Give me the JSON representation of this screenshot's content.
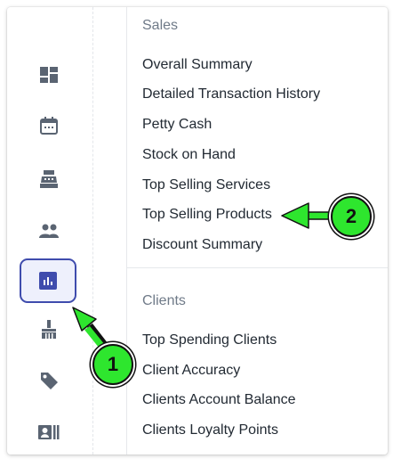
{
  "sidebar": {
    "icons": [
      {
        "name": "dashboard-icon",
        "active": false
      },
      {
        "name": "calendar-icon",
        "active": false
      },
      {
        "name": "cash-register-icon",
        "active": false
      },
      {
        "name": "clients-icon",
        "active": false
      },
      {
        "name": "reports-icon",
        "active": true
      },
      {
        "name": "services-icon",
        "active": false
      },
      {
        "name": "tag-icon",
        "active": false
      },
      {
        "name": "id-card-icon",
        "active": false
      }
    ]
  },
  "menu": {
    "sales": {
      "heading": "Sales",
      "items": [
        "Overall Summary",
        "Detailed Transaction History",
        "Petty Cash",
        "Stock on Hand",
        "Top Selling Services",
        "Top Selling Products",
        "Discount Summary"
      ]
    },
    "clients": {
      "heading": "Clients",
      "items": [
        "Top Spending Clients",
        "Client Accuracy",
        "Clients Account Balance",
        "Clients Loyalty Points"
      ]
    }
  },
  "callouts": [
    {
      "number": "1",
      "target": "reports-icon"
    },
    {
      "number": "2",
      "target": "Top Selling Products"
    }
  ],
  "colors": {
    "icon_gray": "#5a6472",
    "accent": "#3f4cad",
    "callout_green": "#2ee62e",
    "heading_gray": "#6f7a88",
    "text": "#222a33"
  }
}
